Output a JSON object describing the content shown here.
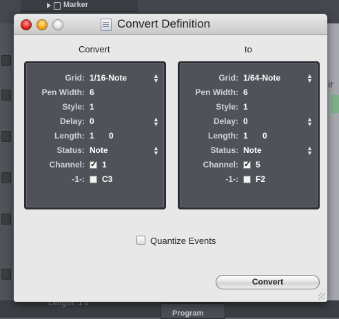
{
  "background": {
    "marker_label": "Marker",
    "length_label": "Length:  1    0",
    "program_label": "Program",
    "right_partial": "ir"
  },
  "window": {
    "title": "Convert Definition",
    "convert_heading": "Convert",
    "to_heading": "to"
  },
  "left_panel": {
    "grid_label": "Grid:",
    "grid_value": "1/16-Note",
    "pen_width_label": "Pen Width:",
    "pen_width_value": "6",
    "style_label": "Style:",
    "style_value": "1",
    "delay_label": "Delay:",
    "delay_value": "0",
    "length_label": "Length:",
    "length_value": "1",
    "length_value2": "0",
    "status_label": "Status:",
    "status_value": "Note",
    "channel_label": "Channel:",
    "channel_checked": true,
    "channel_value": "1",
    "m1_label": "-1-:",
    "m1_checked": false,
    "m1_value": "C3"
  },
  "right_panel": {
    "grid_label": "Grid:",
    "grid_value": "1/64-Note",
    "pen_width_label": "Pen Width:",
    "pen_width_value": "6",
    "style_label": "Style:",
    "style_value": "1",
    "delay_label": "Delay:",
    "delay_value": "0",
    "length_label": "Length:",
    "length_value": "1",
    "length_value2": "0",
    "status_label": "Status:",
    "status_value": "Note",
    "channel_label": "Channel:",
    "channel_checked": true,
    "channel_value": "5",
    "m1_label": "-1-:",
    "m1_checked": false,
    "m1_value": "F2"
  },
  "options": {
    "quantize_label": "Quantize Events",
    "quantize_checked": false
  },
  "actions": {
    "convert_label": "Convert"
  }
}
